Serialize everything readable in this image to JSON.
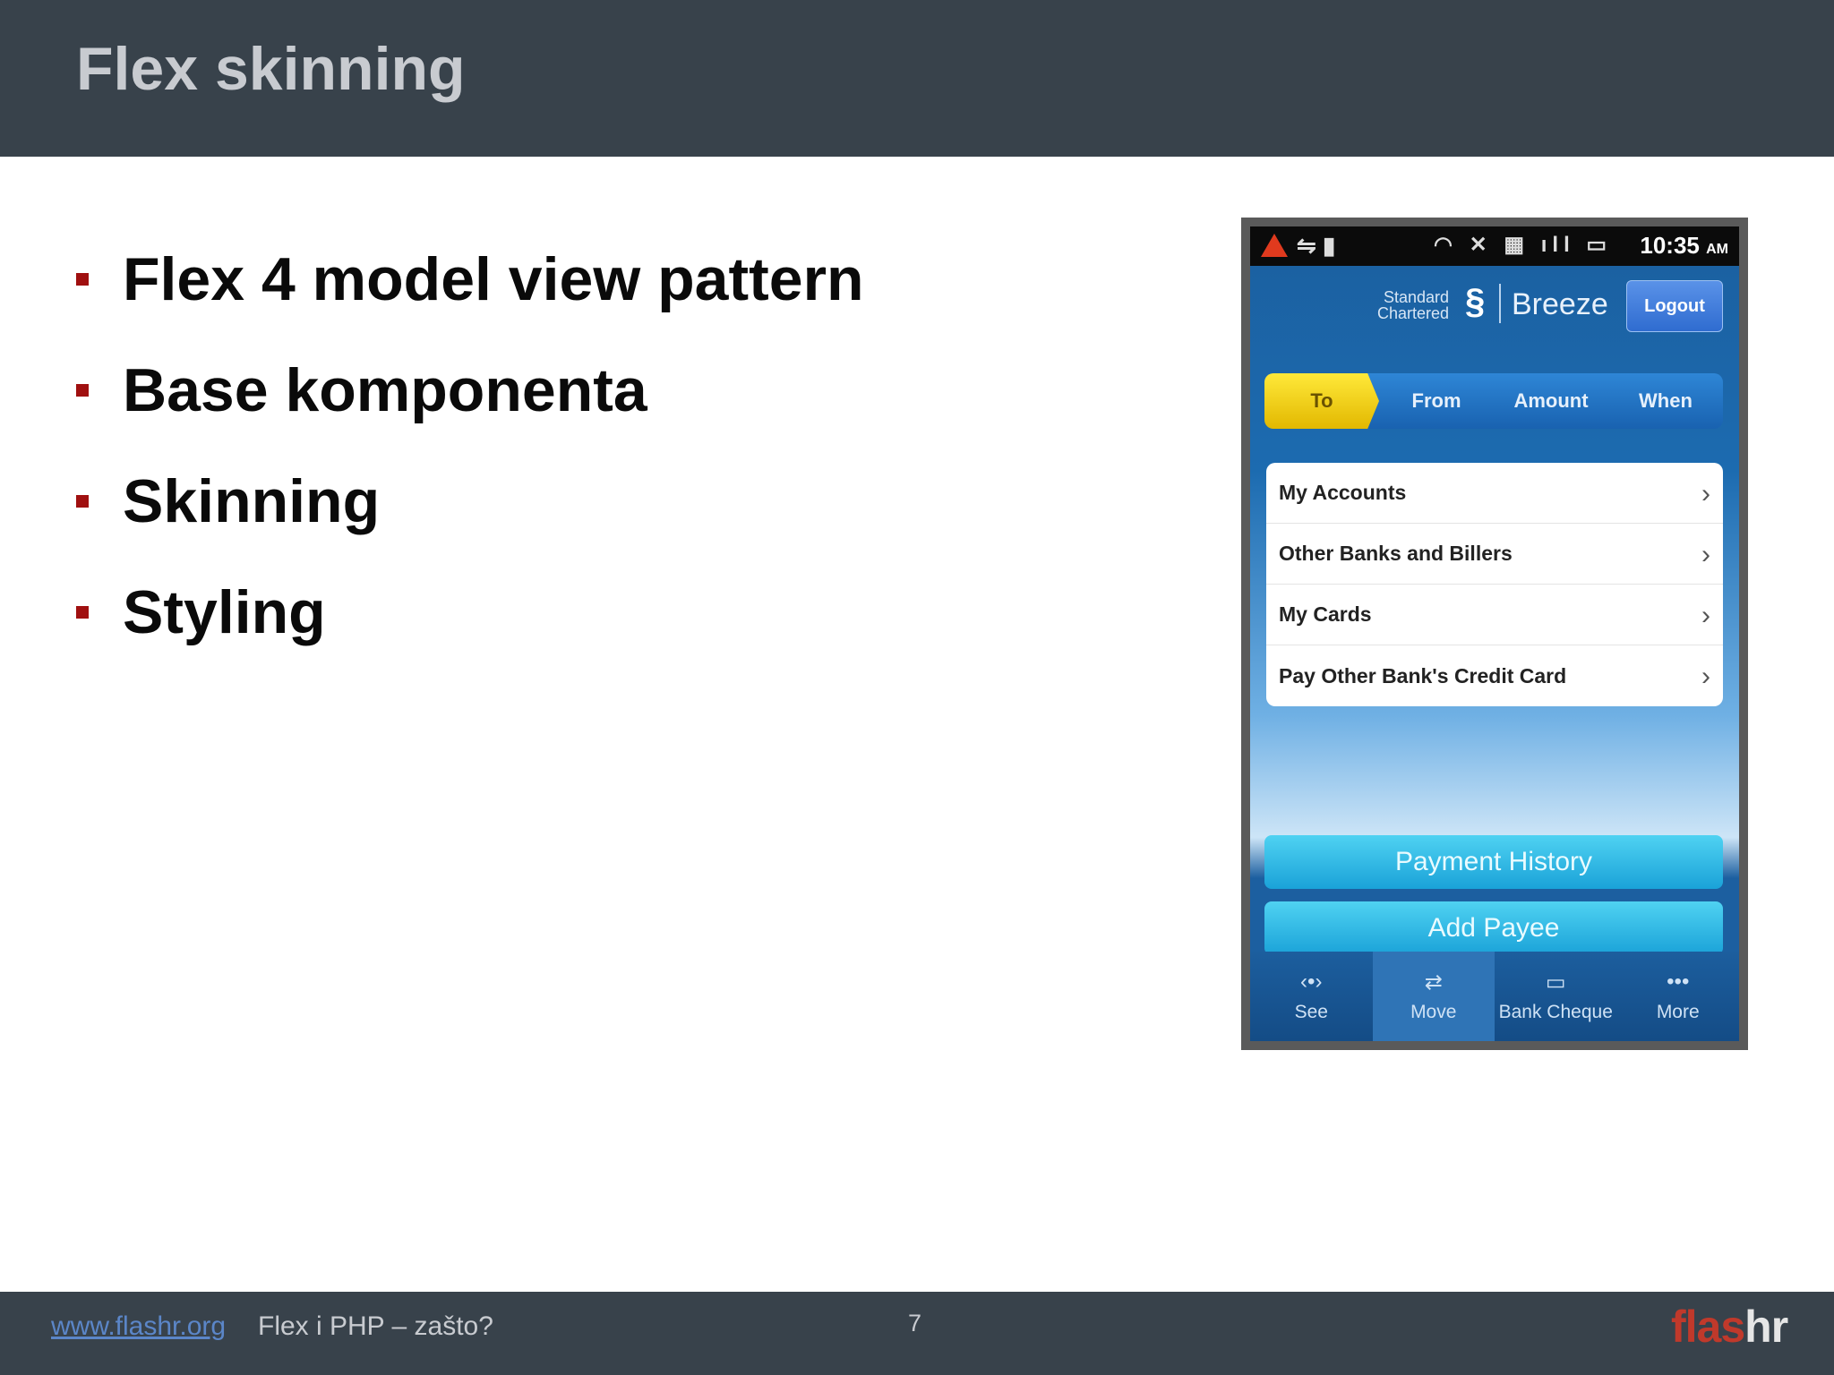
{
  "slide": {
    "title": "Flex skinning",
    "bullets": [
      "Flex 4 model view pattern",
      "Base komponenta",
      "Skinning",
      "Styling"
    ]
  },
  "footer": {
    "link": "www.flashr.org",
    "subtitle": "Flex i PHP – zašto?",
    "page_number": "7",
    "logo_part1": "flas",
    "logo_part2": "hr"
  },
  "phone": {
    "status": {
      "time": "10:35",
      "ampm": "AM"
    },
    "brand": {
      "bank_line1": "Standard",
      "bank_line2": "Chartered",
      "app_name": "Breeze",
      "logout_label": "Logout"
    },
    "steps": [
      "To",
      "From",
      "Amount",
      "When"
    ],
    "menu": [
      "My Accounts",
      "Other Banks and Billers",
      "My Cards",
      "Pay Other Bank's Credit Card"
    ],
    "actions": {
      "payment_history": "Payment History",
      "add_payee": "Add Payee"
    },
    "tabs": [
      "See",
      "Move",
      "Bank Cheque",
      "More"
    ]
  }
}
